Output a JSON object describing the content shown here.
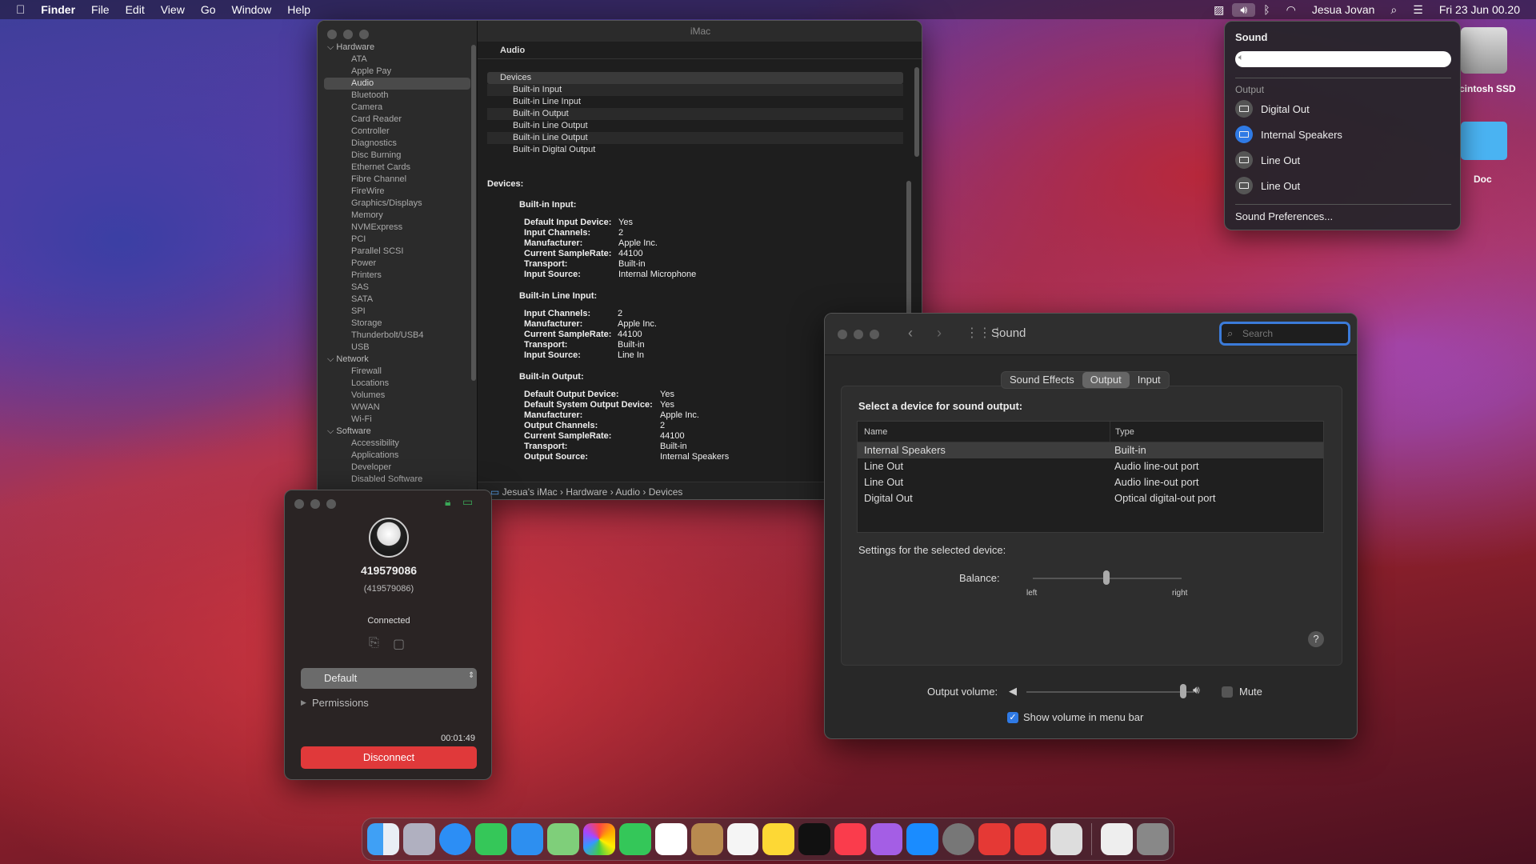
{
  "menubar": {
    "apple": "",
    "app": "Finder",
    "items": [
      "File",
      "Edit",
      "View",
      "Go",
      "Window",
      "Help"
    ],
    "user": "Jesua Jovan",
    "datetime": "Fri 23 Jun  00.20"
  },
  "sysinfo": {
    "window_title": "iMac",
    "sidebar": [
      {
        "label": "Hardware",
        "group": true
      },
      {
        "label": "ATA"
      },
      {
        "label": "Apple Pay"
      },
      {
        "label": "Audio",
        "selected": true
      },
      {
        "label": "Bluetooth"
      },
      {
        "label": "Camera"
      },
      {
        "label": "Card Reader"
      },
      {
        "label": "Controller"
      },
      {
        "label": "Diagnostics"
      },
      {
        "label": "Disc Burning"
      },
      {
        "label": "Ethernet Cards"
      },
      {
        "label": "Fibre Channel"
      },
      {
        "label": "FireWire"
      },
      {
        "label": "Graphics/Displays"
      },
      {
        "label": "Memory"
      },
      {
        "label": "NVMExpress"
      },
      {
        "label": "PCI"
      },
      {
        "label": "Parallel SCSI"
      },
      {
        "label": "Power"
      },
      {
        "label": "Printers"
      },
      {
        "label": "SAS"
      },
      {
        "label": "SATA"
      },
      {
        "label": "SPI"
      },
      {
        "label": "Storage"
      },
      {
        "label": "Thunderbolt/USB4"
      },
      {
        "label": "USB"
      },
      {
        "label": "Network",
        "group": true
      },
      {
        "label": "Firewall"
      },
      {
        "label": "Locations"
      },
      {
        "label": "Volumes"
      },
      {
        "label": "WWAN"
      },
      {
        "label": "Wi-Fi"
      },
      {
        "label": "Software",
        "group": true
      },
      {
        "label": "Accessibility"
      },
      {
        "label": "Applications"
      },
      {
        "label": "Developer"
      },
      {
        "label": "Disabled Software"
      }
    ],
    "header": "Audio",
    "devices_header": "Devices",
    "devices": [
      "Built-in Input",
      "Built-in Line Input",
      "Built-in Output",
      "Built-in Line Output",
      "Built-in Line Output",
      "Built-in Digital Output"
    ],
    "detail_title": "Devices:",
    "sections": [
      {
        "title": "Built-in Input:",
        "rows": [
          [
            "Default Input Device:",
            "Yes"
          ],
          [
            "Input Channels:",
            "2"
          ],
          [
            "Manufacturer:",
            "Apple Inc."
          ],
          [
            "Current SampleRate:",
            "44100"
          ],
          [
            "Transport:",
            "Built-in"
          ],
          [
            "Input Source:",
            "Internal Microphone"
          ]
        ]
      },
      {
        "title": "Built-in Line Input:",
        "rows": [
          [
            "Input Channels:",
            "2"
          ],
          [
            "Manufacturer:",
            "Apple Inc."
          ],
          [
            "Current SampleRate:",
            "44100"
          ],
          [
            "Transport:",
            "Built-in"
          ],
          [
            "Input Source:",
            "Line In"
          ]
        ]
      },
      {
        "title": "Built-in Output:",
        "rows": [
          [
            "Default Output Device:",
            "Yes"
          ],
          [
            "Default System Output Device:",
            "Yes"
          ],
          [
            "Manufacturer:",
            "Apple Inc."
          ],
          [
            "Output Channels:",
            "2"
          ],
          [
            "Current SampleRate:",
            "44100"
          ],
          [
            "Transport:",
            "Built-in"
          ],
          [
            "Output Source:",
            "Internal Speakers"
          ]
        ]
      }
    ],
    "path": [
      "Jesua's iMac",
      "Hardware",
      "Audio",
      "Devices"
    ]
  },
  "sound": {
    "title": "Sound",
    "search_placeholder": "Search",
    "tabs": [
      "Sound Effects",
      "Output",
      "Input"
    ],
    "select_label": "Select a device for sound output:",
    "columns": [
      "Name",
      "Type"
    ],
    "rows": [
      [
        "Internal Speakers",
        "Built-in"
      ],
      [
        "Line Out",
        "Audio line-out port"
      ],
      [
        "Line Out",
        "Audio line-out port"
      ],
      [
        "Digital Out",
        "Optical digital-out port"
      ]
    ],
    "settings_label": "Settings for the selected device:",
    "balance_label": "Balance:",
    "left": "left",
    "right": "right",
    "output_volume_label": "Output volume:",
    "mute": "Mute",
    "show_volume": "Show volume in menu bar",
    "help": "?"
  },
  "call": {
    "number": "419579086",
    "number_sub": "(419579086)",
    "status": "Connected",
    "device": "Default",
    "permissions": "Permissions",
    "timer": "00:01:49",
    "disconnect": "Disconnect"
  },
  "sound_menu": {
    "title": "Sound",
    "output_label": "Output",
    "outputs": [
      "Digital Out",
      "Internal Speakers",
      "Line Out",
      "Line Out"
    ],
    "preferences": "Sound Preferences..."
  },
  "desktop": {
    "drive": "cintosh SSD",
    "folder": "Doc"
  }
}
